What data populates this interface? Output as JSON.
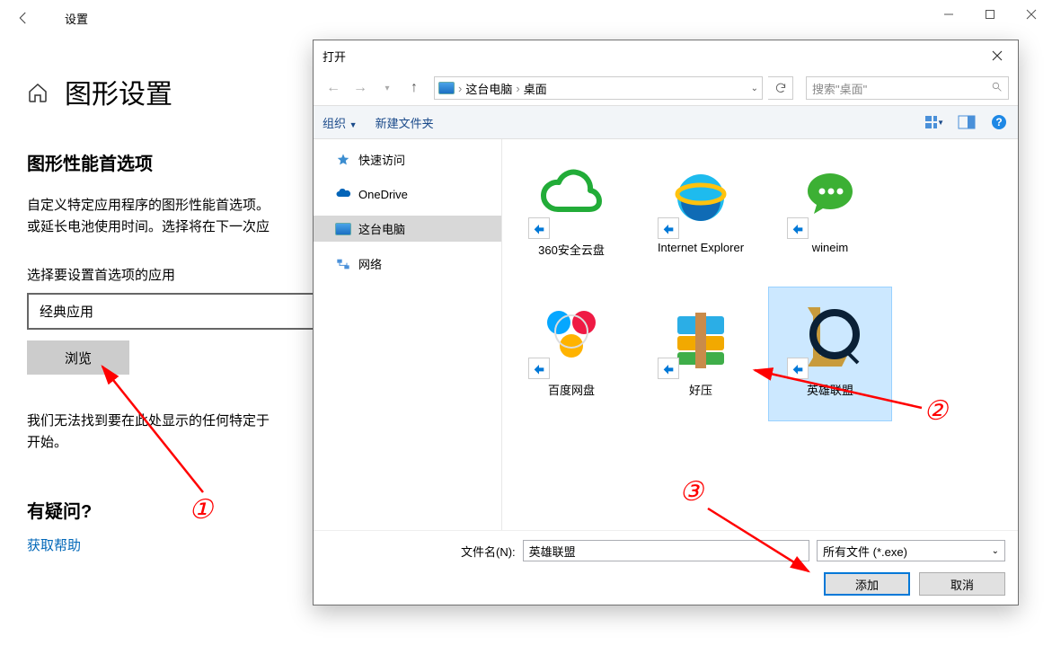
{
  "settings": {
    "title": "设置",
    "page_title": "图形设置",
    "section_heading": "图形性能首选项",
    "description": "自定义特定应用程序的图形性能首选项。\n或延长电池使用时间。选择将在下一次应",
    "select_label": "选择要设置首选项的应用",
    "select_value": "经典应用",
    "browse_label": "浏览",
    "note": "我们无法找到要在此处显示的任何特定于\n开始。",
    "question_heading": "有疑问?",
    "help_link": "获取帮助"
  },
  "dialog": {
    "title": "打开",
    "breadcrumb": [
      "这台电脑",
      "桌面"
    ],
    "search_placeholder": "搜索\"桌面\"",
    "toolbar": {
      "organize": "组织",
      "new_folder": "新建文件夹"
    },
    "nav_items": [
      {
        "label": "快速访问",
        "icon": "star"
      },
      {
        "label": "OneDrive",
        "icon": "cloud"
      },
      {
        "label": "这台电脑",
        "icon": "pc",
        "selected": true
      },
      {
        "label": "网络",
        "icon": "network"
      }
    ],
    "files": [
      {
        "label": "360安全云盘",
        "icon": "360"
      },
      {
        "label": "Internet Explorer",
        "icon": "ie"
      },
      {
        "label": "wineim",
        "icon": "wineim"
      },
      {
        "label": "百度网盘",
        "icon": "baidu"
      },
      {
        "label": "好压",
        "icon": "haozip"
      },
      {
        "label": "英雄联盟",
        "icon": "lol",
        "selected": true
      }
    ],
    "filename_label": "文件名(N):",
    "filename_value": "英雄联盟",
    "filter_value": "所有文件 (*.exe)",
    "add_label": "添加",
    "cancel_label": "取消"
  },
  "annotations": {
    "a1": "①",
    "a2": "②",
    "a3": "③"
  }
}
